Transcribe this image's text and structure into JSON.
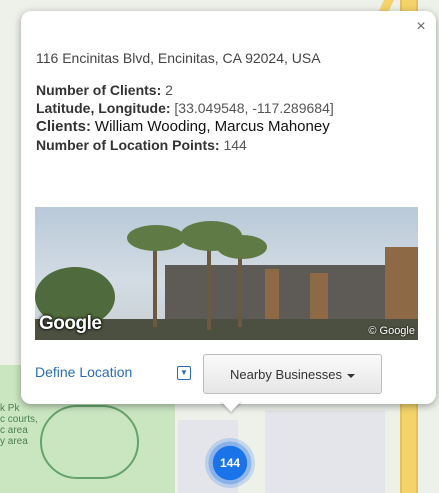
{
  "popup": {
    "address": "116 Encinitas Blvd, Encinitas, CA 92024, USA",
    "close_icon": "×",
    "fields": [
      {
        "label": "Number of Clients:",
        "value": "2"
      },
      {
        "label": "Latitude, Longitude:",
        "value": "[33.049548, -117.289684]"
      },
      {
        "label": "Clients:",
        "value": "William Wooding, Marcus Mahoney"
      },
      {
        "label": "Number of Location Points:",
        "value": "144"
      }
    ],
    "streetview": {
      "logo": "Google",
      "copyright": "© Google"
    },
    "define_location_label": "Define Location",
    "dropdown_icon": "▼",
    "nearby_businesses_label": "Nearby Businesses"
  },
  "map": {
    "park_label": "k Pk\nc courts,\nc area\ny area",
    "cluster_count": "144"
  },
  "colors": {
    "link": "#2a6db5",
    "cluster": "#1a73e8",
    "road_major": "#f3d36a",
    "park": "#c9e6c1"
  }
}
